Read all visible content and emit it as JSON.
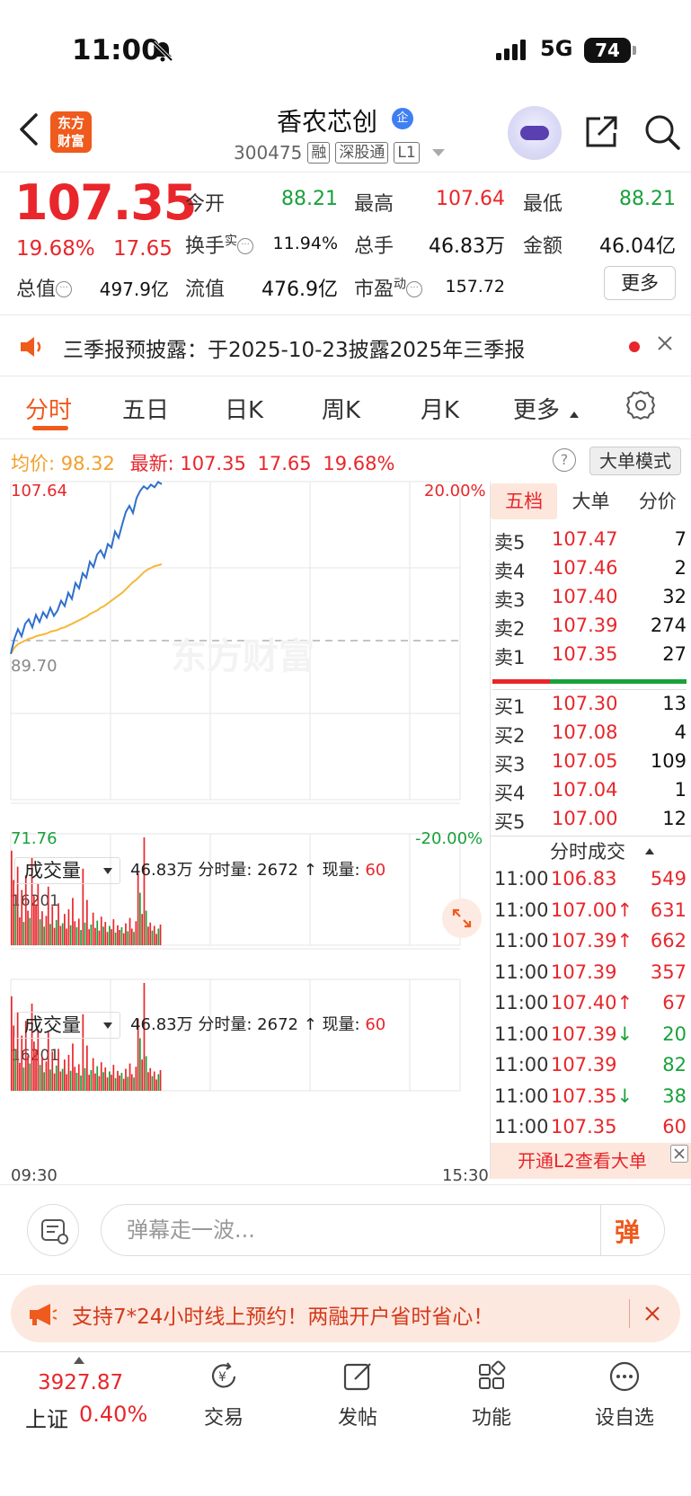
{
  "status_bar": {
    "time": "11:00",
    "network": "5G",
    "battery": "74"
  },
  "header": {
    "logo_line1": "东方",
    "logo_line2": "财富",
    "stock_name": "香农芯创",
    "verified_mark": "企",
    "stock_code": "300475",
    "tags": [
      "融",
      "深股通",
      "L1"
    ]
  },
  "quote": {
    "price": "107.35",
    "change_pct": "19.68%",
    "change": "17.65",
    "open_label": "今开",
    "open": "88.21",
    "high_label": "最高",
    "high": "107.64",
    "low_label": "最低",
    "low": "88.21",
    "turnover_label": "换手",
    "turnover_sup": "实",
    "turnover": "11.94%",
    "volume_label": "总手",
    "volume": "46.83万",
    "amount_label": "金额",
    "amount": "46.04亿",
    "mcap_label": "总值",
    "mcap": "497.9亿",
    "float_label": "流值",
    "float": "476.9亿",
    "pe_label": "市盈",
    "pe_sup": "动",
    "pe": "157.72",
    "more_button": "更多"
  },
  "notice": {
    "text": "三季报预披露：于2025-10-23披露2025年三季报"
  },
  "tabs": [
    "分时",
    "五日",
    "日K",
    "周K",
    "月K",
    "更多"
  ],
  "info_row": {
    "avg_label": "均价:",
    "avg": "98.32",
    "latest_label": "最新:",
    "latest": "107.35",
    "latest_chg": "17.65",
    "latest_pct": "19.68%",
    "big_order_mode": "大单模式"
  },
  "chart_data": {
    "type": "line",
    "title": "",
    "y_top_price": "107.64",
    "y_mid_price": "89.70",
    "y_bottom_price": "71.76",
    "y_top_pct": "20.00%",
    "y_bottom_pct": "-20.00%",
    "x_start": "09:30",
    "x_end": "15:30",
    "watermark": "东方财富",
    "ylim": [
      71.76,
      107.64
    ],
    "series": [
      {
        "name": "",
        "color": "#2f6fcb",
        "values": [
          88.2,
          89.9,
          91.0,
          90.2,
          91.6,
          92.1,
          91.2,
          92.6,
          91.8,
          92.9,
          92.3,
          93.4,
          92.5,
          93.1,
          94.2,
          93.6,
          95.1,
          94.4,
          96.2,
          95.6,
          97.3,
          96.8,
          98.6,
          98.0,
          99.4,
          99.9,
          99.1,
          100.6,
          100.2,
          102.0,
          101.3,
          102.8,
          104.2,
          104.9,
          104.1,
          105.8,
          106.6,
          107.1,
          106.8,
          107.3,
          107.0,
          107.6,
          107.35
        ]
      },
      {
        "name": "",
        "color": "#f5b73b",
        "values": [
          88.2,
          88.9,
          89.3,
          89.5,
          89.7,
          89.9,
          90.0,
          90.2,
          90.3,
          90.4,
          90.5,
          90.7,
          90.8,
          90.9,
          91.1,
          91.2,
          91.4,
          91.6,
          91.8,
          92.0,
          92.2,
          92.4,
          92.7,
          92.9,
          93.1,
          93.4,
          93.6,
          93.9,
          94.2,
          94.5,
          94.8,
          95.1,
          95.5,
          95.9,
          96.3,
          96.6,
          97.0,
          97.4,
          97.7,
          97.9,
          98.1,
          98.2,
          98.32
        ]
      }
    ],
    "volume": {
      "label": "成交量",
      "total": "46.83万",
      "minute_label": "分时量:",
      "minute": "2672",
      "current_label": "现量:",
      "current": "60",
      "max_label": "16201",
      "bars": [
        {
          "v": 14200,
          "c": "red"
        },
        {
          "v": 9800,
          "c": "red"
        },
        {
          "v": 6200,
          "c": "green"
        },
        {
          "v": 11800,
          "c": "red"
        },
        {
          "v": 4200,
          "c": "red"
        },
        {
          "v": 8300,
          "c": "red"
        },
        {
          "v": 3500,
          "c": "green"
        },
        {
          "v": 10500,
          "c": "red"
        },
        {
          "v": 5200,
          "c": "red"
        },
        {
          "v": 4100,
          "c": "green"
        },
        {
          "v": 13100,
          "c": "red"
        },
        {
          "v": 7400,
          "c": "red"
        },
        {
          "v": 6100,
          "c": "red"
        },
        {
          "v": 9200,
          "c": "red"
        },
        {
          "v": 3900,
          "c": "green"
        },
        {
          "v": 5100,
          "c": "red"
        },
        {
          "v": 2800,
          "c": "green"
        },
        {
          "v": 4400,
          "c": "red"
        },
        {
          "v": 8800,
          "c": "red"
        },
        {
          "v": 3200,
          "c": "green"
        },
        {
          "v": 5900,
          "c": "red"
        },
        {
          "v": 2600,
          "c": "red"
        },
        {
          "v": 3800,
          "c": "green"
        },
        {
          "v": 6300,
          "c": "red"
        },
        {
          "v": 2900,
          "c": "red"
        },
        {
          "v": 3300,
          "c": "green"
        },
        {
          "v": 4700,
          "c": "red"
        },
        {
          "v": 2500,
          "c": "red"
        },
        {
          "v": 5400,
          "c": "red"
        },
        {
          "v": 3000,
          "c": "green"
        },
        {
          "v": 7100,
          "c": "red"
        },
        {
          "v": 3600,
          "c": "red"
        },
        {
          "v": 2700,
          "c": "green"
        },
        {
          "v": 4000,
          "c": "red"
        },
        {
          "v": 2300,
          "c": "green"
        },
        {
          "v": 11500,
          "c": "red"
        },
        {
          "v": 3400,
          "c": "green"
        },
        {
          "v": 6800,
          "c": "red"
        },
        {
          "v": 2400,
          "c": "red"
        },
        {
          "v": 3100,
          "c": "green"
        },
        {
          "v": 4900,
          "c": "red"
        },
        {
          "v": 2600,
          "c": "red"
        },
        {
          "v": 3700,
          "c": "green"
        },
        {
          "v": 2200,
          "c": "red"
        },
        {
          "v": 4300,
          "c": "red"
        },
        {
          "v": 2800,
          "c": "green"
        },
        {
          "v": 3500,
          "c": "red"
        },
        {
          "v": 2000,
          "c": "red"
        },
        {
          "v": 2900,
          "c": "green"
        },
        {
          "v": 2400,
          "c": "red"
        },
        {
          "v": 3900,
          "c": "red"
        },
        {
          "v": 1900,
          "c": "green"
        },
        {
          "v": 3000,
          "c": "red"
        },
        {
          "v": 2300,
          "c": "red"
        },
        {
          "v": 2700,
          "c": "green"
        },
        {
          "v": 1800,
          "c": "red"
        },
        {
          "v": 3300,
          "c": "red"
        },
        {
          "v": 2100,
          "c": "green"
        },
        {
          "v": 4100,
          "c": "red"
        },
        {
          "v": 2500,
          "c": "red"
        },
        {
          "v": 2000,
          "c": "green"
        },
        {
          "v": 3600,
          "c": "red"
        },
        {
          "v": 10800,
          "c": "red"
        },
        {
          "v": 7900,
          "c": "green"
        },
        {
          "v": 4700,
          "c": "red"
        },
        {
          "v": 16201,
          "c": "red"
        },
        {
          "v": 5200,
          "c": "green"
        },
        {
          "v": 2800,
          "c": "red"
        },
        {
          "v": 3400,
          "c": "red"
        },
        {
          "v": 2200,
          "c": "green"
        },
        {
          "v": 2900,
          "c": "red"
        },
        {
          "v": 1700,
          "c": "red"
        },
        {
          "v": 2500,
          "c": "green"
        },
        {
          "v": 3100,
          "c": "red"
        }
      ]
    }
  },
  "order_book": {
    "tabs": [
      "五档",
      "大单",
      "分价"
    ],
    "asks": [
      {
        "label": "卖5",
        "price": "107.47",
        "vol": "7"
      },
      {
        "label": "卖4",
        "price": "107.46",
        "vol": "2"
      },
      {
        "label": "卖3",
        "price": "107.40",
        "vol": "32"
      },
      {
        "label": "卖2",
        "price": "107.39",
        "vol": "274"
      },
      {
        "label": "卖1",
        "price": "107.35",
        "vol": "27"
      }
    ],
    "bids": [
      {
        "label": "买1",
        "price": "107.30",
        "vol": "13"
      },
      {
        "label": "买2",
        "price": "107.08",
        "vol": "4"
      },
      {
        "label": "买3",
        "price": "107.05",
        "vol": "109"
      },
      {
        "label": "买4",
        "price": "107.04",
        "vol": "1"
      },
      {
        "label": "买5",
        "price": "107.00",
        "vol": "12"
      }
    ],
    "ticks_title": "分时成交",
    "ticks": [
      {
        "time": "11:00",
        "price": "106.83",
        "arrow": "",
        "vol": "549",
        "vol_color": "red"
      },
      {
        "time": "11:00",
        "price": "107.00",
        "arrow": "↑",
        "vol": "631",
        "vol_color": "red"
      },
      {
        "time": "11:00",
        "price": "107.39",
        "arrow": "↑",
        "vol": "662",
        "vol_color": "red"
      },
      {
        "time": "11:00",
        "price": "107.39",
        "arrow": "",
        "vol": "357",
        "vol_color": "red"
      },
      {
        "time": "11:00",
        "price": "107.40",
        "arrow": "↑",
        "vol": "67",
        "vol_color": "red"
      },
      {
        "time": "11:00",
        "price": "107.39",
        "arrow": "↓",
        "vol": "20",
        "vol_color": "green"
      },
      {
        "time": "11:00",
        "price": "107.39",
        "arrow": "",
        "vol": "82",
        "vol_color": "green"
      },
      {
        "time": "11:00",
        "price": "107.35",
        "arrow": "↓",
        "vol": "38",
        "vol_color": "green"
      },
      {
        "time": "11:00",
        "price": "107.35",
        "arrow": "",
        "vol": "60",
        "vol_color": "red"
      }
    ],
    "l2_banner": "开通L2查看大单"
  },
  "danmu": {
    "placeholder": "弹幕走一波...",
    "send": "弹"
  },
  "promo": {
    "text": "支持7*24小时线上预约！两融开户省时省心！"
  },
  "bottom_nav": {
    "index_value": "3927.87",
    "index_name": "上证",
    "index_pct": "0.40%",
    "items": [
      "交易",
      "发帖",
      "功能",
      "设自选"
    ]
  },
  "colors": {
    "up": "#e8262b",
    "down": "#19a13b",
    "brand": "#ef5a1d",
    "price_line": "#2f6fcb",
    "avg_line": "#f5b73b"
  }
}
